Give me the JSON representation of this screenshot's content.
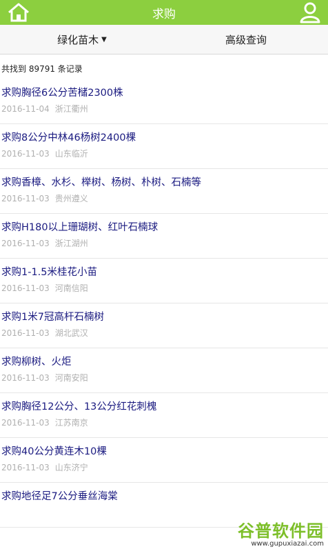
{
  "header": {
    "title": "求购",
    "home_icon": "home-icon",
    "user_icon": "user-icon",
    "bg": "#8ccf3f"
  },
  "tabs": [
    {
      "label": "绿化苗木",
      "dropdown": true
    },
    {
      "label": "高级查询"
    }
  ],
  "summary": "共找到 89791 条记录",
  "items": [
    {
      "title": "求购胸径6公分苦槠2300株",
      "date": "2016-11-04",
      "location": "浙江衢州"
    },
    {
      "title": "求购8公分中林46杨树2400棵",
      "date": "2016-11-03",
      "location": "山东临沂"
    },
    {
      "title": "求购香樟、水杉、榉树、杨树、朴树、石楠等",
      "date": "2016-11-03",
      "location": "贵州遵义"
    },
    {
      "title": "求购H180以上珊瑚树、红叶石楠球",
      "date": "2016-11-03",
      "location": "浙江湖州"
    },
    {
      "title": "求购1-1.5米桂花小苗",
      "date": "2016-11-03",
      "location": "河南信阳"
    },
    {
      "title": "求购1米7冠高杆石楠树",
      "date": "2016-11-03",
      "location": "湖北武汉"
    },
    {
      "title": "求购柳树、火炬",
      "date": "2016-11-03",
      "location": "河南安阳"
    },
    {
      "title": "求购胸径12公分、13公分红花刺槐",
      "date": "2016-11-03",
      "location": "江苏南京"
    },
    {
      "title": "求购40公分黄连木10棵",
      "date": "2016-11-03",
      "location": "山东济宁"
    },
    {
      "title": "求购地径足7公分垂丝海棠",
      "date": "",
      "location": ""
    }
  ],
  "watermark": {
    "main": "谷普软件园",
    "url": "www.gupuxiazai.com"
  }
}
